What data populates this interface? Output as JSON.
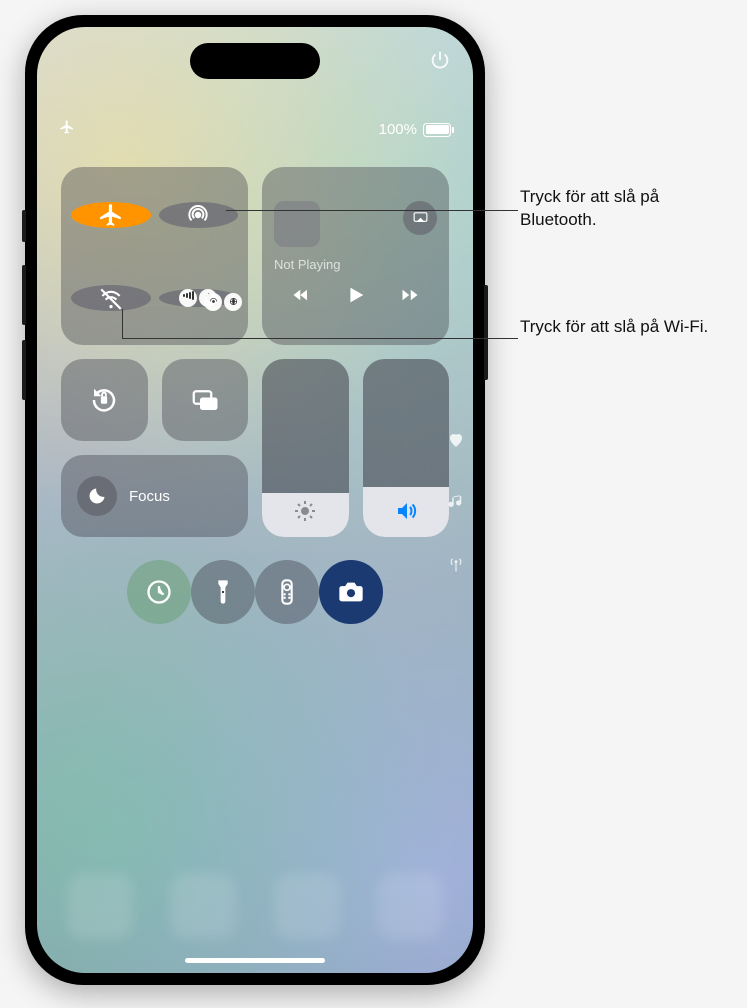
{
  "status": {
    "battery_text": "100%"
  },
  "media": {
    "title": "Not Playing"
  },
  "focus": {
    "label": "Focus"
  },
  "callouts": {
    "bluetooth": "Tryck för att slå på Bluetooth.",
    "wifi": "Tryck för att slå på Wi-Fi."
  },
  "icons": {
    "add": "plus-icon",
    "power": "power-icon",
    "airplane": "airplane-icon",
    "airdrop": "airdrop-icon",
    "wifi": "wifi-off-icon",
    "cellular": "cellular-icon",
    "bluetooth": "bluetooth-icon",
    "hotspot": "hotspot-icon",
    "airplay": "airplay-icon",
    "rewind": "rewind-icon",
    "play": "play-icon",
    "forward": "forward-icon",
    "orientation_lock": "orientation-lock-icon",
    "screen_mirror": "screen-mirror-icon",
    "moon": "do-not-disturb-icon",
    "brightness": "brightness-icon",
    "volume": "volume-icon",
    "timer": "timer-icon",
    "flashlight": "flashlight-icon",
    "remote": "remote-icon",
    "camera": "camera-icon",
    "heart": "heart-icon",
    "music_note": "music-note-icon",
    "antenna": "antenna-icon"
  }
}
